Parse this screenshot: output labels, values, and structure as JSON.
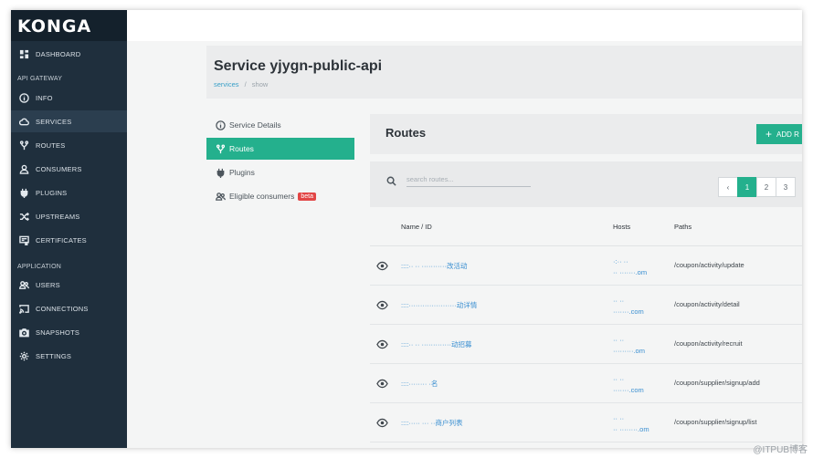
{
  "app": {
    "logo": "KONGA"
  },
  "sidebar": {
    "dashboard": "DASHBOARD",
    "section_api": "API GATEWAY",
    "info": "INFO",
    "services": "SERVICES",
    "routes": "ROUTES",
    "consumers": "CONSUMERS",
    "plugins": "PLUGINS",
    "upstreams": "UPSTREAMS",
    "certificates": "CERTIFICATES",
    "section_app": "APPLICATION",
    "users": "USERS",
    "connections": "CONNECTIONS",
    "snapshots": "SNAPSHOTS",
    "settings": "SETTINGS"
  },
  "header": {
    "title": "Service yjygn-public-api",
    "crumb_services": "services",
    "crumb_sep": "/",
    "crumb_show": "show"
  },
  "subnav": {
    "service_details": "Service Details",
    "routes": "Routes",
    "plugins": "Plugins",
    "eligible_consumers": "Eligible consumers",
    "beta": "beta"
  },
  "routes": {
    "title": "Routes",
    "add_label": "ADD R",
    "search_placeholder": "search routes...",
    "pager": {
      "prev": "‹",
      "p1": "1",
      "p2": "2",
      "p3": "3"
    },
    "columns": {
      "name": "Name / ID",
      "hosts": "Hosts",
      "paths": "Paths"
    },
    "rows": [
      {
        "name": "::::·· ·· ···········改活动",
        "host1": "·:·· ··",
        "host2": "·· ·······.om",
        "path": "/coupon/activity/update"
      },
      {
        "name": "::::·····················动详情",
        "host1": "·· ··",
        "host2": "·······.com",
        "path": "/coupon/activity/detail"
      },
      {
        "name": "::::·· ·· ·············动招募",
        "host1": "·· ··",
        "host2": "·········.om",
        "path": "/coupon/activity/recruit"
      },
      {
        "name": "::::········ ·名",
        "host1": "·· ··",
        "host2": "·······.com",
        "path": "/coupon/supplier/signup/add"
      },
      {
        "name": "::::····· ··· ··商户列表",
        "host1": "·· ··",
        "host2": "·· ········.om",
        "path": "/coupon/supplier/signup/list"
      }
    ]
  },
  "watermark": "@ITPUB博客"
}
